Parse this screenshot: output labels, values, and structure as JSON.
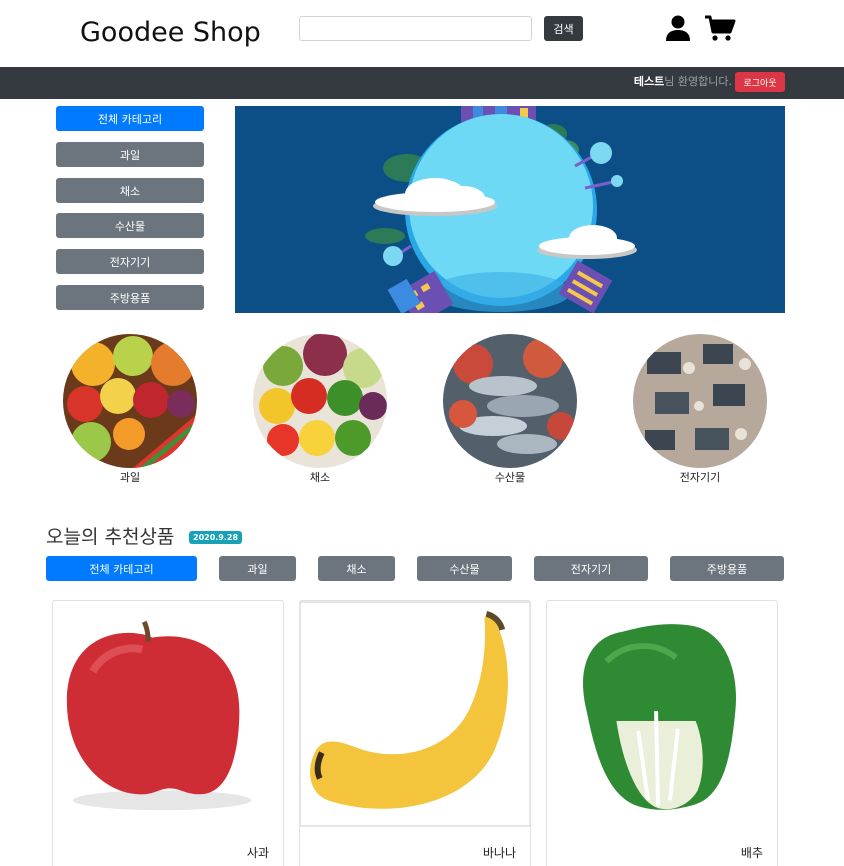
{
  "header": {
    "brand": "Goodee Shop",
    "search_placeholder": "",
    "search_button": "검색",
    "user_icon": "user-icon",
    "cart_icon": "cart-icon"
  },
  "navbar": {
    "user_name": "테스트",
    "welcome_suffix": "님 환영합니다.",
    "logout_button": "로그아웃"
  },
  "side_categories": [
    {
      "label": "전체 카테고리",
      "active": true
    },
    {
      "label": "과일"
    },
    {
      "label": "채소"
    },
    {
      "label": "수산물"
    },
    {
      "label": "전자기기"
    },
    {
      "label": "주방용품"
    }
  ],
  "featured_categories": [
    {
      "label": "과일"
    },
    {
      "label": "채소"
    },
    {
      "label": "수산물"
    },
    {
      "label": "전자기기"
    }
  ],
  "recommend": {
    "title": "오늘의 추천상품",
    "date": "2020.9.28",
    "tabs": [
      {
        "label": "전체 카테고리",
        "active": true
      },
      {
        "label": "과일"
      },
      {
        "label": "채소"
      },
      {
        "label": "수산물"
      },
      {
        "label": "전자기기"
      },
      {
        "label": "주방용품"
      }
    ]
  },
  "products": [
    {
      "name": "사과"
    },
    {
      "name": "바나나"
    },
    {
      "name": "배추"
    }
  ],
  "colors": {
    "primary": "#007bff",
    "secondary": "#6c757d",
    "dark": "#343a40",
    "danger": "#dc3545",
    "info": "#17a2b8"
  }
}
